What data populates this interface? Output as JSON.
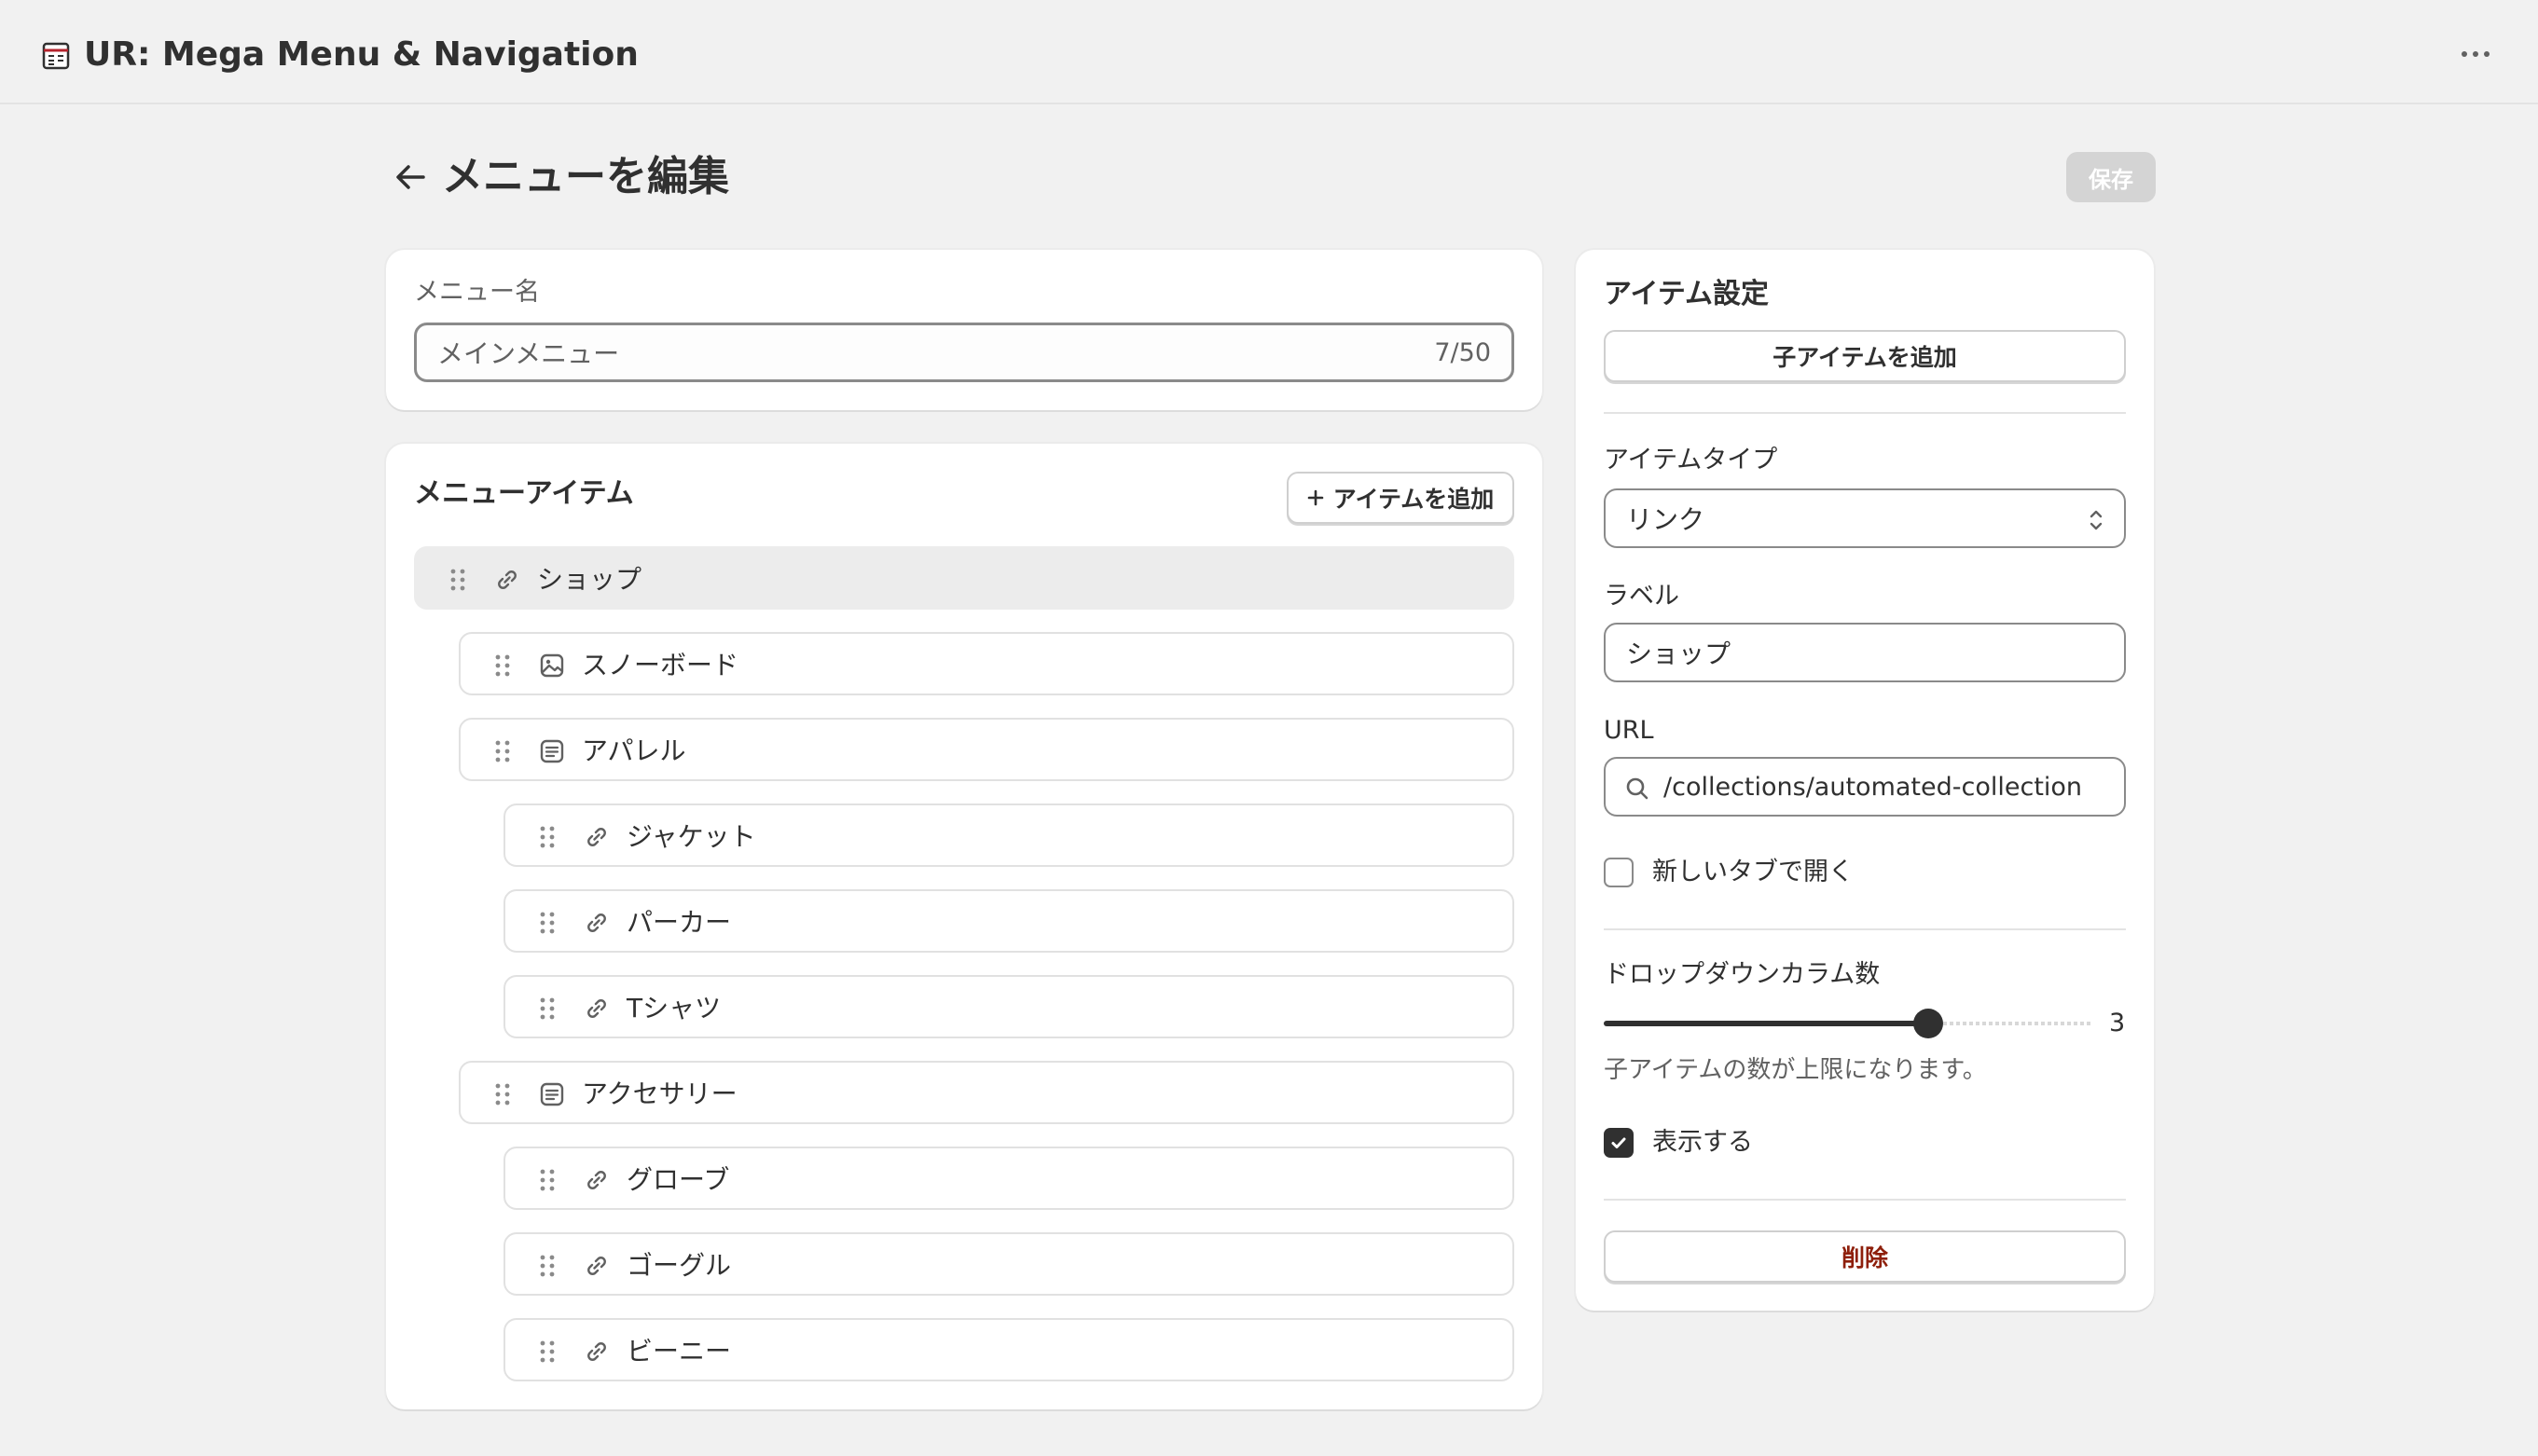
{
  "app": {
    "title": "UR: Mega Menu & Navigation"
  },
  "page": {
    "title": "メニューを編集",
    "save_label": "保存"
  },
  "menu_name": {
    "label": "メニュー名",
    "value": "メインメニュー",
    "char_count": "7/50"
  },
  "menu_items": {
    "heading": "メニューアイテム",
    "add_label": "アイテムを追加",
    "items": [
      {
        "label": "ショップ",
        "icon": "link-icon",
        "level": 0,
        "selected": true
      },
      {
        "label": "スノーボード",
        "icon": "image-icon",
        "level": 1
      },
      {
        "label": "アパレル",
        "icon": "list-icon",
        "level": 1
      },
      {
        "label": "ジャケット",
        "icon": "link-icon",
        "level": 2
      },
      {
        "label": "パーカー",
        "icon": "link-icon",
        "level": 2
      },
      {
        "label": "Tシャツ",
        "icon": "link-icon",
        "level": 2
      },
      {
        "label": "アクセサリー",
        "icon": "list-icon",
        "level": 1
      },
      {
        "label": "グローブ",
        "icon": "link-icon",
        "level": 2
      },
      {
        "label": "ゴーグル",
        "icon": "link-icon",
        "level": 2
      },
      {
        "label": "ビーニー",
        "icon": "link-icon",
        "level": 2
      }
    ]
  },
  "item_settings": {
    "heading": "アイテム設定",
    "add_child_label": "子アイテムを追加",
    "item_type": {
      "label": "アイテムタイプ",
      "value": "リンク"
    },
    "label_field": {
      "label": "ラベル",
      "value": "ショップ"
    },
    "url_field": {
      "label": "URL",
      "value": "/collections/automated-collection"
    },
    "new_tab": {
      "label": "新しいタブで開く",
      "checked": false
    },
    "dropdown_columns": {
      "label": "ドロップダウンカラム数",
      "value": "3",
      "max": 5
    },
    "limit_message": "子アイテムの数が上限になります。",
    "visible": {
      "label": "表示する",
      "checked": true
    },
    "delete_label": "削除"
  }
}
